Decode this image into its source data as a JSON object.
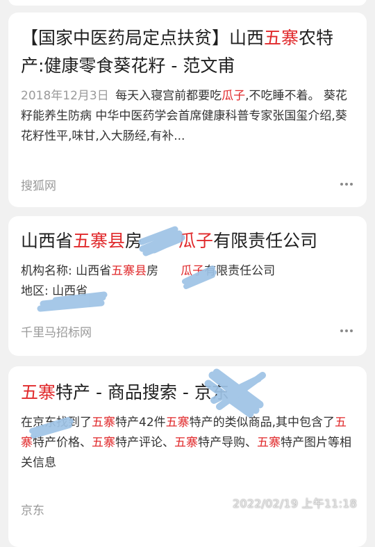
{
  "results": [
    {
      "title_prefix": "【国家中医药局定点扶贫】山西",
      "title_hl": "五寨",
      "title_suffix": "农特产:健康零食葵花籽 - 范文甫",
      "date": "2018年12月3日",
      "snippet_a": "每天入寝宫前都要吃",
      "snippet_hl": "瓜子",
      "snippet_b": ",不吃睡不着。 葵花籽能养生防病 中华中医药学会首席健康科普专家张国玺介绍,葵花籽性平,味甘,入大肠经,有补...",
      "source": "搜狐网"
    },
    {
      "title_a": "山西省",
      "title_hl1": "五寨县",
      "title_mid": "房",
      "title_hl2": "瓜子",
      "title_b": "有限责任公司",
      "snip_a": "机构名称: 山西省",
      "snip_hl1": "五寨县",
      "snip_mid": "房",
      "snip_hl2": "瓜子",
      "snip_b": "有限责任公司",
      "snip_line2": "地区: 山西省",
      "source": "千里马招标网"
    },
    {
      "title_hl": "五寨",
      "title_rest": "特产 - 商品搜索 - 京东",
      "s1": "在京东找到了",
      "s1_hl": "五寨",
      "s2": "特产42件",
      "s2_hl": "五寨",
      "s3": "特产的类似商品,其中包含了",
      "s3_hl": "五寨",
      "s4": "特产价格、",
      "s4_hl": "五寨",
      "s5": "特产评论、",
      "s5_hl": "五寨",
      "s6": "特产导购、",
      "s6_hl": "五寨",
      "s7": "特产图片等相关信息",
      "source": "京东"
    }
  ],
  "timestamp": "2022/02/19 上午11:18",
  "icons": {
    "more": "more-icon"
  },
  "colors": {
    "highlight": "#e0292b",
    "background": "#f1f1f1",
    "source_gray": "#9a9a9a",
    "redaction": "#9ec3e6"
  }
}
